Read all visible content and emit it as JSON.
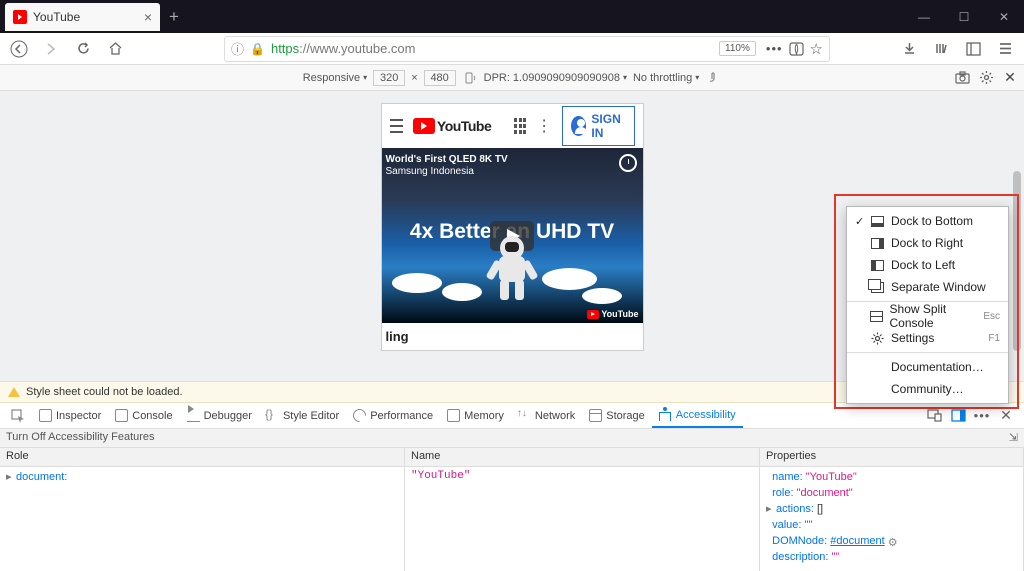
{
  "browser": {
    "tab_title": "YouTube",
    "url_https": "https",
    "url_rest": "://www.youtube.com",
    "zoom": "110%"
  },
  "rdm": {
    "responsive": "Responsive",
    "width": "320",
    "height": "480",
    "dpr_label": "DPR:",
    "dpr_value": "1.0909090909090908",
    "throttle": "No throttling"
  },
  "yt": {
    "logo_text": "YouTube",
    "signin": "SIGN IN",
    "thumb_line1": "World's First QLED 8K TV",
    "thumb_line2": "Samsung Indonesia",
    "thumb_big": "4x Better an UHD TV",
    "thumb_wm": "YouTube",
    "video_title_fragment": "ling"
  },
  "warning": "Style sheet could not be loaded.",
  "devtools": {
    "tabs": {
      "inspector": "Inspector",
      "console": "Console",
      "debugger": "Debugger",
      "style": "Style Editor",
      "perf": "Performance",
      "memory": "Memory",
      "network": "Network",
      "storage": "Storage",
      "access": "Accessibility"
    },
    "turnoff": "Turn Off Accessibility Features",
    "cols": {
      "role": "Role",
      "name": "Name",
      "props": "Properties"
    },
    "tree": {
      "role_val": "document:",
      "name_val": "\"YouTube\""
    },
    "props": {
      "name_k": "name:",
      "name_v": "\"YouTube\"",
      "role_k": "role:",
      "role_v": "\"document\"",
      "actions_k": "actions:",
      "actions_v": "[]",
      "value_k": "value:",
      "value_v": "\"\"",
      "dom_k": "DOMNode:",
      "dom_v": "#document",
      "desc_k": "description:",
      "desc_v": "\"\""
    }
  },
  "dock_menu": {
    "bottom": "Dock to Bottom",
    "right": "Dock to Right",
    "left": "Dock to Left",
    "separate": "Separate Window",
    "split": "Show Split Console",
    "split_key": "Esc",
    "settings": "Settings",
    "settings_key": "F1",
    "docs": "Documentation…",
    "community": "Community…"
  }
}
